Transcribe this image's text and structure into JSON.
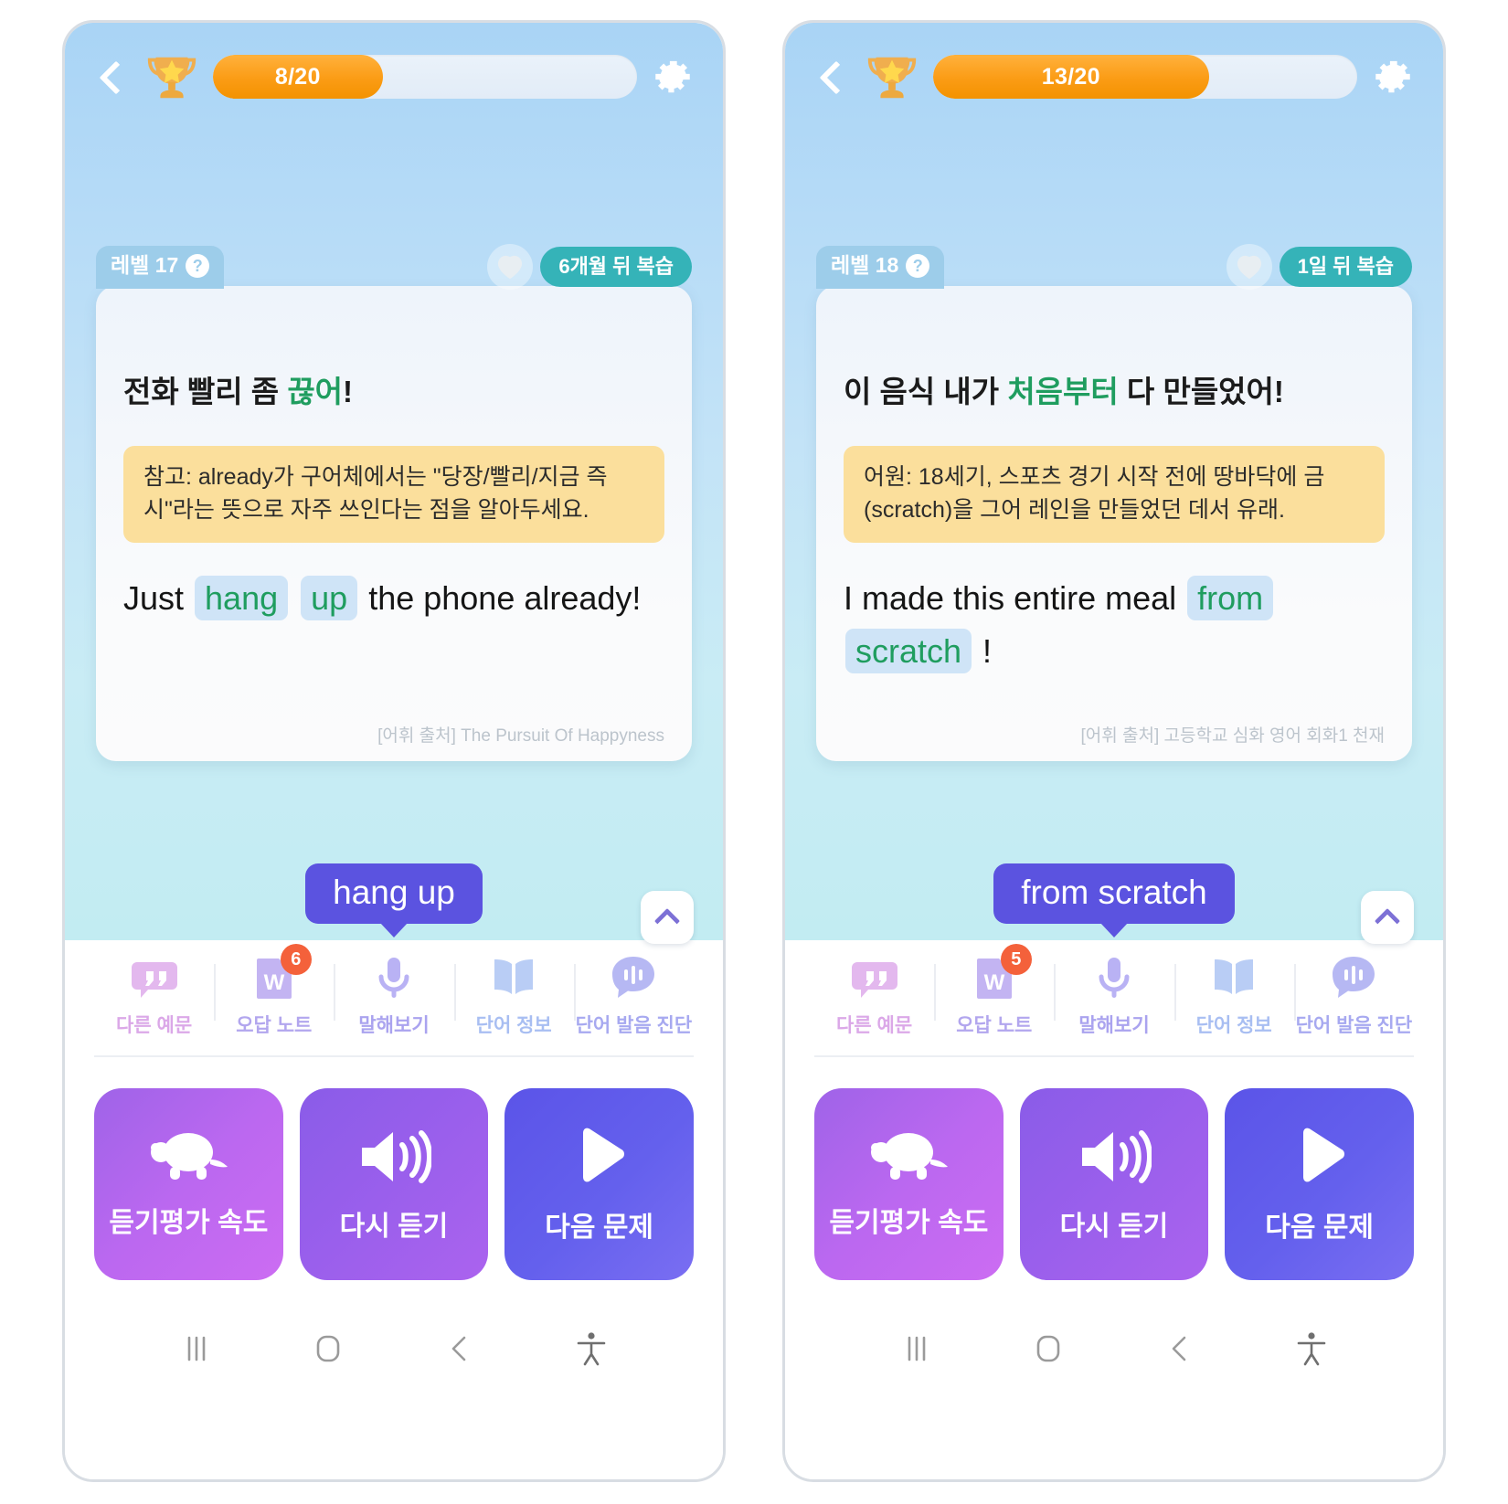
{
  "app": {
    "accent_purple": "#5b53e0",
    "accent_orange": "#f39200",
    "accent_teal": "#35b3b8",
    "highlight_green": "#1f9d5f",
    "note_yellow": "#fbdf9c",
    "word_highlight_bg": "#cfe4f7"
  },
  "phones": [
    {
      "header": {
        "back_icon": "chevron-left-icon",
        "trophy_icon": "trophy-icon",
        "progress_label": "8/20",
        "progress_percent": 40,
        "settings_icon": "gear-icon"
      },
      "card": {
        "level_label": "레벨 17",
        "level_help": "?",
        "favorite_icon": "heart-icon",
        "review_badge": "6개월 뒤 복습",
        "kr_before": "전화 빨리 좀 ",
        "kr_highlight": "끊어",
        "kr_after": "!",
        "note_label": "참고:",
        "note_text": " already가 구어체에서는 \"당장/빨리/지금 즉시\"라는 뜻으로 자주 쓰인다는 점을 알아두세요.",
        "en_part1": "Just ",
        "en_hl1": "hang",
        "en_part2": " ",
        "en_hl2": "up",
        "en_part3": " the phone already!",
        "source": "[어휘 출처] The Pursuit Of Happyness"
      },
      "bubble": {
        "word": "hang up",
        "collapse_icon": "chevron-up-icon"
      },
      "tools": [
        {
          "label": "다른 예문",
          "icon": "quote-bubble-icon",
          "color": "#e3b8ee",
          "badge": null
        },
        {
          "label": "오답 노트",
          "icon": "wrong-answer-note-icon",
          "color": "#c3b4f2",
          "badge": "6"
        },
        {
          "label": "말해보기",
          "icon": "microphone-icon",
          "color": "#b9b2f4",
          "badge": null
        },
        {
          "label": "단어 정보",
          "icon": "open-book-icon",
          "color": "#b9cdf5",
          "badge": null
        },
        {
          "label": "단어 발음 진단",
          "icon": "speech-waveform-icon",
          "color": "#b6b8f3",
          "badge": null
        }
      ],
      "actions": [
        {
          "label": "듣기평가 속도",
          "icon": "turtle-icon"
        },
        {
          "label": "다시 듣기",
          "icon": "speaker-icon"
        },
        {
          "label": "다음 문제",
          "icon": "play-icon"
        }
      ],
      "navbar": [
        {
          "icon": "recents-icon"
        },
        {
          "icon": "home-icon"
        },
        {
          "icon": "back-icon"
        },
        {
          "icon": "accessibility-icon"
        }
      ]
    },
    {
      "header": {
        "back_icon": "chevron-left-icon",
        "trophy_icon": "trophy-icon",
        "progress_label": "13/20",
        "progress_percent": 65,
        "settings_icon": "gear-icon"
      },
      "card": {
        "level_label": "레벨 18",
        "level_help": "?",
        "favorite_icon": "heart-icon",
        "review_badge": "1일 뒤 복습",
        "kr_before": "이 음식 내가 ",
        "kr_highlight": "처음부터",
        "kr_after": " 다 만들었어!",
        "note_label": "어원:",
        "note_text": " 18세기, 스포츠 경기 시작 전에 땅바닥에 금(scratch)을 그어 레인을 만들었던 데서 유래.",
        "en_part1": "I made this entire meal ",
        "en_hl1": "from",
        "en_part2": " ",
        "en_hl2": "scratch",
        "en_part3": " !",
        "source": "[어휘 출처] 고등학교 심화 영어 회화1 천재"
      },
      "bubble": {
        "word": "from scratch",
        "collapse_icon": "chevron-up-icon"
      },
      "tools": [
        {
          "label": "다른 예문",
          "icon": "quote-bubble-icon",
          "color": "#e3b8ee",
          "badge": null
        },
        {
          "label": "오답 노트",
          "icon": "wrong-answer-note-icon",
          "color": "#c3b4f2",
          "badge": "5"
        },
        {
          "label": "말해보기",
          "icon": "microphone-icon",
          "color": "#b9b2f4",
          "badge": null
        },
        {
          "label": "단어 정보",
          "icon": "open-book-icon",
          "color": "#b9cdf5",
          "badge": null
        },
        {
          "label": "단어 발음 진단",
          "icon": "speech-waveform-icon",
          "color": "#b6b8f3",
          "badge": null
        }
      ],
      "actions": [
        {
          "label": "듣기평가 속도",
          "icon": "turtle-icon"
        },
        {
          "label": "다시 듣기",
          "icon": "speaker-icon"
        },
        {
          "label": "다음 문제",
          "icon": "play-icon"
        }
      ],
      "navbar": [
        {
          "icon": "recents-icon"
        },
        {
          "icon": "home-icon"
        },
        {
          "icon": "back-icon"
        },
        {
          "icon": "accessibility-icon"
        }
      ]
    }
  ]
}
